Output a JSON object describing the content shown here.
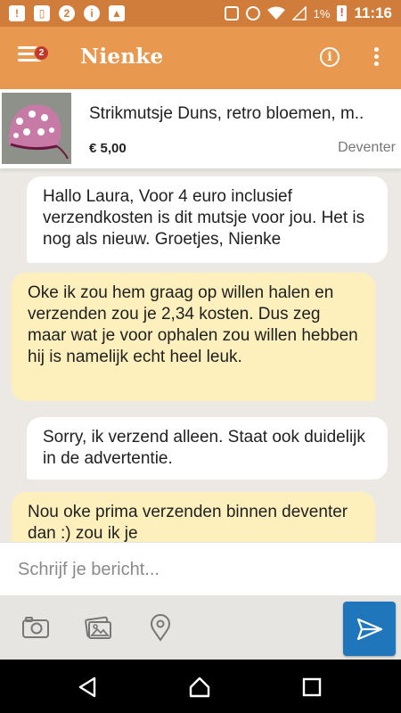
{
  "status_bar": {
    "battery_percent": "1%",
    "time": "11:16",
    "left_icons": [
      "alert-icon",
      "sim-alert-icon",
      "app-icon",
      "info-icon",
      "image-icon"
    ],
    "right_icons": [
      "vibrate-icon",
      "alarm-icon",
      "wifi-icon",
      "signal-icon",
      "battery-low-icon"
    ]
  },
  "header": {
    "menu_badge": "2",
    "title": "Nienke",
    "info_label": "i"
  },
  "product": {
    "title": "Strikmutsje Duns, retro bloemen, m..",
    "price": "€ 5,00",
    "location": "Deventer"
  },
  "messages": [
    {
      "direction": "incoming",
      "text": "Hallo Laura, Voor 4 euro inclusief verzendkosten is dit mutsje voor jou. Het is nog als nieuw. Groetjes, Nienke"
    },
    {
      "direction": "outgoing",
      "text": "Oke ik zou hem graag op willen halen en verzenden zou je 2,34 kosten. Dus zeg maar wat je voor ophalen zou willen hebben hij is namelijk echt heel leuk."
    },
    {
      "direction": "incoming",
      "text": "Sorry, ik verzend alleen. Staat ook duidelijk in de advertentie."
    },
    {
      "direction": "outgoing",
      "text": "Nou oke prima verzenden binnen deventer dan :) zou ik je"
    }
  ],
  "composer": {
    "placeholder": "Schrijf je bericht...",
    "value": ""
  },
  "toolbar_icons": [
    "camera-icon",
    "gallery-icon",
    "location-pin-icon",
    "send-icon"
  ],
  "colors": {
    "status_bar": "#d07c3a",
    "app_bar": "#e9984f",
    "badge": "#c0392b",
    "incoming_bubble": "#ffffff",
    "outgoing_bubble": "#fdf0bd",
    "send_button": "#1f76bb",
    "chat_background": "#ece9e4"
  }
}
